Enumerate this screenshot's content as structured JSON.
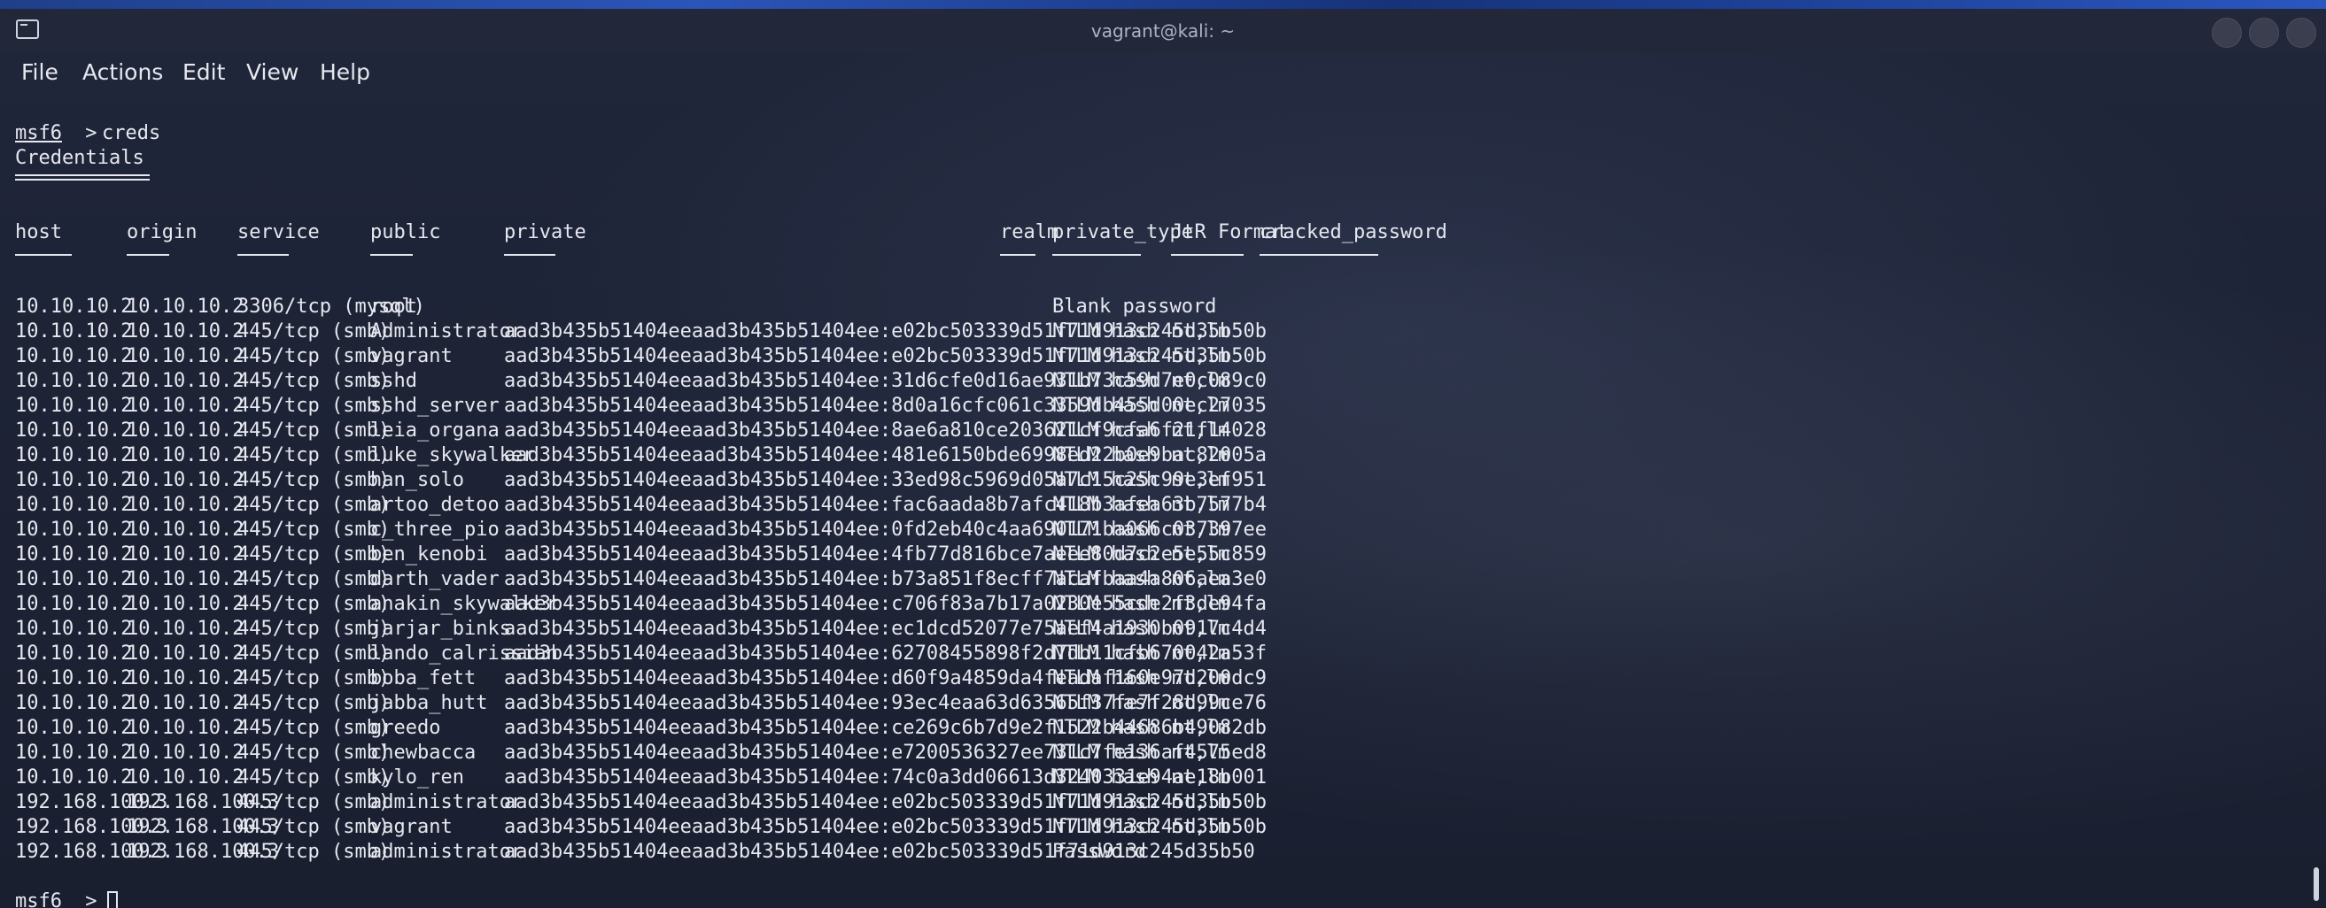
{
  "window": {
    "title": "vagrant@kali: ~"
  },
  "menu": [
    "File",
    "Actions",
    "Edit",
    "View",
    "Help"
  ],
  "prompt": "msf6",
  "command": "creds",
  "heading": "Credentials",
  "columns": [
    "host",
    "origin",
    "service",
    "public",
    "private",
    "realm",
    "private_type",
    "JtR Format",
    "cracked_password"
  ],
  "rows": [
    [
      "10.10.10.2",
      "10.10.10.2",
      "3306/tcp (mysql)",
      "root",
      "",
      "",
      "Blank password",
      "",
      ""
    ],
    [
      "10.10.10.2",
      "10.10.10.2",
      "445/tcp (smb)",
      "Administrator",
      "aad3b435b51404eeaad3b435b51404ee:e02bc503339d51f71d913c245d35b50b",
      "",
      "NTLM hash",
      "nt,lm",
      ""
    ],
    [
      "10.10.10.2",
      "10.10.10.2",
      "445/tcp (smb)",
      "vagrant",
      "aad3b435b51404eeaad3b435b51404ee:e02bc503339d51f71d913c245d35b50b",
      "",
      "NTLM hash",
      "nt,lm",
      ""
    ],
    [
      "10.10.10.2",
      "10.10.10.2",
      "445/tcp (smb)",
      "sshd",
      "aad3b435b51404eeaad3b435b51404ee:31d6cfe0d16ae931b73c59d7e0c089c0",
      "",
      "NTLM hash",
      "nt,lm",
      ""
    ],
    [
      "10.10.10.2",
      "10.10.10.2",
      "445/tcp (smb)",
      "sshd_server",
      "aad3b435b51404eeaad3b435b51404ee:8d0a16cfc061c3359db455d00ec27035",
      "",
      "NTLM hash",
      "nt,lm",
      ""
    ],
    [
      "10.10.10.2",
      "10.10.10.2",
      "445/tcp (smb)",
      "leia_organa",
      "aad3b435b51404eeaad3b435b51404ee:8ae6a810ce203621cf9cfa6f21f14028",
      "",
      "NTLM hash",
      "nt,lm",
      ""
    ],
    [
      "10.10.10.2",
      "10.10.10.2",
      "445/tcp (smb)",
      "luke_skywalker",
      "aad3b435b51404eeaad3b435b51404ee:481e6150bde6998ed22b0e9bac82005a",
      "",
      "NTLM hash",
      "nt,lm",
      ""
    ],
    [
      "10.10.10.2",
      "10.10.10.2",
      "445/tcp (smb)",
      "han_solo",
      "aad3b435b51404eeaad3b435b51404ee:33ed98c5969d05a7c15c25c99e3ef951",
      "",
      "NTLM hash",
      "nt,lm",
      ""
    ],
    [
      "10.10.10.2",
      "10.10.10.2",
      "445/tcp (smb)",
      "artoo_detoo",
      "aad3b435b51404eeaad3b435b51404ee:fac6aada8b7afc418b3afea63b7577b4",
      "",
      "NTLM hash",
      "nt,lm",
      ""
    ],
    [
      "10.10.10.2",
      "10.10.10.2",
      "445/tcp (smb)",
      "c_three_pio",
      "aad3b435b51404eeaad3b435b51404ee:0fd2eb40c4aa690171ba066c037397ee",
      "",
      "NTLM hash",
      "nt,lm",
      ""
    ],
    [
      "10.10.10.2",
      "10.10.10.2",
      "445/tcp (smb)",
      "ben_kenobi",
      "aad3b435b51404eeaad3b435b51404ee:4fb77d816bce7aeee80d7c2e5e55c859",
      "",
      "NTLM hash",
      "nt,lm",
      ""
    ],
    [
      "10.10.10.2",
      "10.10.10.2",
      "445/tcp (smb)",
      "darth_vader",
      "aad3b435b51404eeaad3b435b51404ee:b73a851f8ecff7acafbaa4a806aea3e0",
      "",
      "NTLM hash",
      "nt,lm",
      ""
    ],
    [
      "10.10.10.2",
      "10.10.10.2",
      "445/tcp (smb)",
      "anakin_skywalker",
      "aad3b435b51404eeaad3b435b51404ee:c706f83a7b17a0230e55cde2f3de94fa",
      "",
      "NTLM hash",
      "nt,lm",
      ""
    ],
    [
      "10.10.10.2",
      "10.10.10.2",
      "445/tcp (smb)",
      "jarjar_binks",
      "aad3b435b51404eeaad3b435b51404ee:ec1dcd52077e75aef4a1930b0917c4d4",
      "",
      "NTLM hash",
      "nt,lm",
      ""
    ],
    [
      "10.10.10.2",
      "10.10.10.2",
      "445/tcp (smb)",
      "lando_calrissian",
      "aad3b435b51404eeaad3b435b51404ee:62708455898f2d7db11cfb670042a53f",
      "",
      "NTLM hash",
      "nt,lm",
      ""
    ],
    [
      "10.10.10.2",
      "10.10.10.2",
      "445/tcp (smb)",
      "boba_fett",
      "aad3b435b51404eeaad3b435b51404ee:d60f9a4859da4feadaf160e97d200dc9",
      "",
      "NTLM hash",
      "nt,lm",
      ""
    ],
    [
      "10.10.10.2",
      "10.10.10.2",
      "445/tcp (smb)",
      "jabba_hutt",
      "aad3b435b51404eeaad3b435b51404ee:93ec4eaa63d63565f37fe7f28d99ce76",
      "",
      "NTLM hash",
      "nt,lm",
      ""
    ],
    [
      "10.10.10.2",
      "10.10.10.2",
      "445/tcp (smb)",
      "greedo",
      "aad3b435b51404eeaad3b435b51404ee:ce269c6b7d9e2f1522b44686b49082db",
      "",
      "NTLM hash",
      "nt,lm",
      ""
    ],
    [
      "10.10.10.2",
      "10.10.10.2",
      "445/tcp (smb)",
      "chewbacca",
      "aad3b435b51404eeaad3b435b51404ee:e7200536327ee731c7fe136af4575ed8",
      "",
      "NTLM hash",
      "nt,lm",
      ""
    ],
    [
      "10.10.10.2",
      "10.10.10.2",
      "445/tcp (smb)",
      "kylo_ren",
      "aad3b435b51404eeaad3b435b51404ee:74c0a3dd06613d3240331e94ae18b001",
      "",
      "NTLM hash",
      "nt,lm",
      ""
    ],
    [
      "192.168.100.3",
      "192.168.100.3",
      "445/tcp (smb)",
      "administrator",
      "aad3b435b51404eeaad3b435b51404ee:e02bc503339d51f71d913c245d35b50b",
      ".",
      "NTLM hash",
      "nt,lm",
      ""
    ],
    [
      "192.168.100.3",
      "192.168.100.3",
      "445/tcp (smb)",
      "vagrant",
      "aad3b435b51404eeaad3b435b51404ee:e02bc503339d51f71d913c245d35b50b",
      ".",
      "NTLM hash",
      "nt,lm",
      ""
    ],
    [
      "192.168.100.3",
      "192.168.100.3",
      "445/tcp (smb)",
      "administrator",
      "aad3b435b51404eeaad3b435b51404ee:e02bc503339d51f71d913c245d35b50",
      ".",
      "Password",
      "",
      ""
    ]
  ]
}
